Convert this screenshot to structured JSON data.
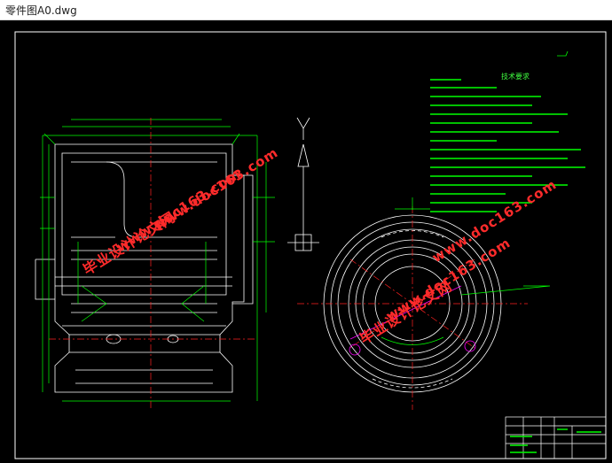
{
  "window": {
    "title": "零件图A0.dwg"
  },
  "drawing": {
    "notes_title": "技术要求",
    "colors": {
      "background": "#000000",
      "outline": "#ffffff",
      "dimension": "#00ff00",
      "centerline": "#ff2020",
      "leader": "#ff00ff"
    }
  },
  "watermarks": [
    {
      "line1": "毕业设计论文网",
      "line2": "www.doc163.com"
    },
    {
      "line1": "毕业设计论文网",
      "line2": "www.doc163.com"
    },
    {
      "line1": "毕业设计论文网",
      "line2": "www.doc163.com"
    },
    {
      "line1": "毕业设计论文网",
      "line2": "www.doc163.com"
    }
  ]
}
